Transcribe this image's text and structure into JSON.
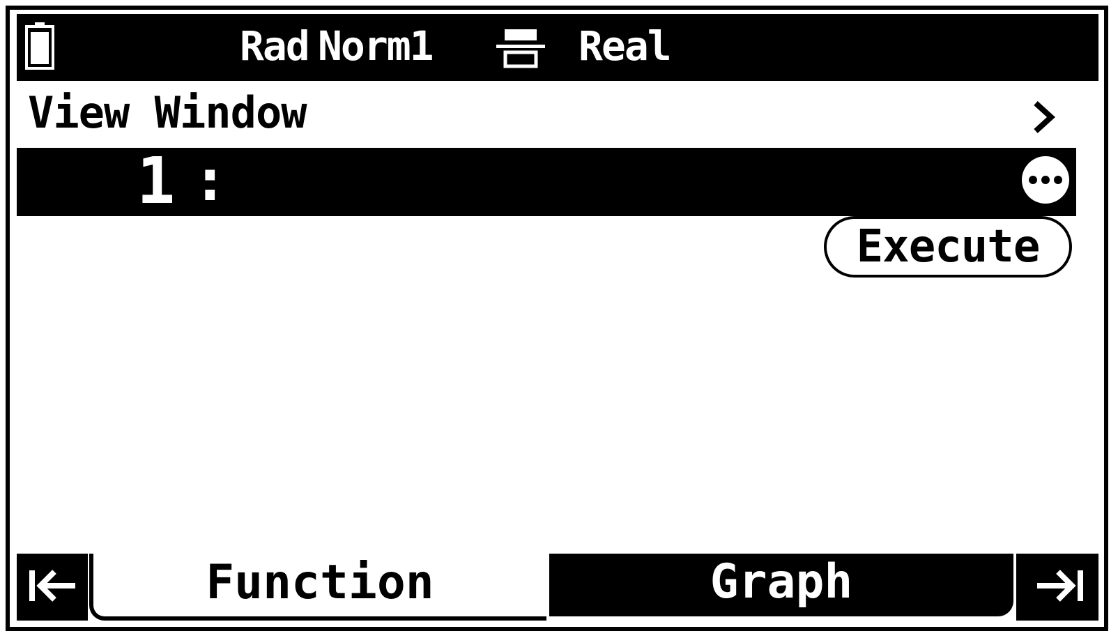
{
  "status_bar": {
    "battery_icon": "battery-icon",
    "angle_unit": "Rad",
    "display_format": "Norm1",
    "input_mode_icon": "math-input-icon",
    "complex_mode": "Real"
  },
  "header": {
    "title": "View Window",
    "chevron_icon": "chevron-right-icon"
  },
  "function_list": {
    "rows": [
      {
        "number": "1",
        "separator": ":",
        "expression": ""
      }
    ],
    "more_icon": "more-options-icon"
  },
  "execute_button": {
    "label": "Execute"
  },
  "tabs": {
    "first_icon": "jump-to-first-icon",
    "items": [
      {
        "label": "Function",
        "selected": true
      },
      {
        "label": "Graph",
        "selected": false
      }
    ],
    "last_icon": "jump-to-last-icon"
  },
  "colors": {
    "foreground": "#000000",
    "background": "#ffffff"
  }
}
